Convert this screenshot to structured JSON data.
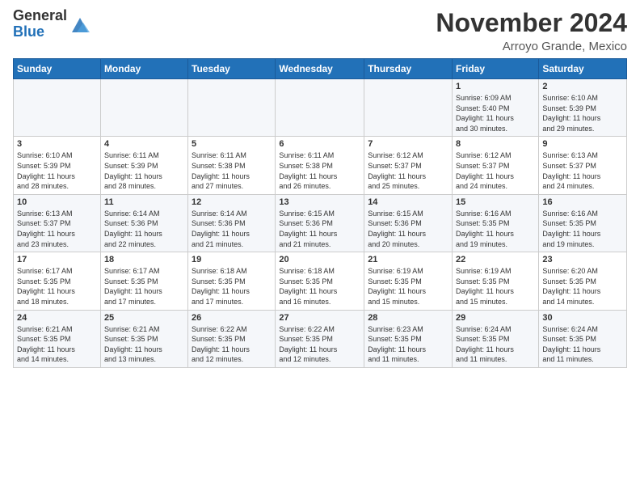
{
  "logo": {
    "general": "General",
    "blue": "Blue"
  },
  "header": {
    "month": "November 2024",
    "location": "Arroyo Grande, Mexico"
  },
  "weekdays": [
    "Sunday",
    "Monday",
    "Tuesday",
    "Wednesday",
    "Thursday",
    "Friday",
    "Saturday"
  ],
  "weeks": [
    [
      {
        "day": "",
        "info": ""
      },
      {
        "day": "",
        "info": ""
      },
      {
        "day": "",
        "info": ""
      },
      {
        "day": "",
        "info": ""
      },
      {
        "day": "",
        "info": ""
      },
      {
        "day": "1",
        "info": "Sunrise: 6:09 AM\nSunset: 5:40 PM\nDaylight: 11 hours\nand 30 minutes."
      },
      {
        "day": "2",
        "info": "Sunrise: 6:10 AM\nSunset: 5:39 PM\nDaylight: 11 hours\nand 29 minutes."
      }
    ],
    [
      {
        "day": "3",
        "info": "Sunrise: 6:10 AM\nSunset: 5:39 PM\nDaylight: 11 hours\nand 28 minutes."
      },
      {
        "day": "4",
        "info": "Sunrise: 6:11 AM\nSunset: 5:39 PM\nDaylight: 11 hours\nand 28 minutes."
      },
      {
        "day": "5",
        "info": "Sunrise: 6:11 AM\nSunset: 5:38 PM\nDaylight: 11 hours\nand 27 minutes."
      },
      {
        "day": "6",
        "info": "Sunrise: 6:11 AM\nSunset: 5:38 PM\nDaylight: 11 hours\nand 26 minutes."
      },
      {
        "day": "7",
        "info": "Sunrise: 6:12 AM\nSunset: 5:37 PM\nDaylight: 11 hours\nand 25 minutes."
      },
      {
        "day": "8",
        "info": "Sunrise: 6:12 AM\nSunset: 5:37 PM\nDaylight: 11 hours\nand 24 minutes."
      },
      {
        "day": "9",
        "info": "Sunrise: 6:13 AM\nSunset: 5:37 PM\nDaylight: 11 hours\nand 24 minutes."
      }
    ],
    [
      {
        "day": "10",
        "info": "Sunrise: 6:13 AM\nSunset: 5:37 PM\nDaylight: 11 hours\nand 23 minutes."
      },
      {
        "day": "11",
        "info": "Sunrise: 6:14 AM\nSunset: 5:36 PM\nDaylight: 11 hours\nand 22 minutes."
      },
      {
        "day": "12",
        "info": "Sunrise: 6:14 AM\nSunset: 5:36 PM\nDaylight: 11 hours\nand 21 minutes."
      },
      {
        "day": "13",
        "info": "Sunrise: 6:15 AM\nSunset: 5:36 PM\nDaylight: 11 hours\nand 21 minutes."
      },
      {
        "day": "14",
        "info": "Sunrise: 6:15 AM\nSunset: 5:36 PM\nDaylight: 11 hours\nand 20 minutes."
      },
      {
        "day": "15",
        "info": "Sunrise: 6:16 AM\nSunset: 5:35 PM\nDaylight: 11 hours\nand 19 minutes."
      },
      {
        "day": "16",
        "info": "Sunrise: 6:16 AM\nSunset: 5:35 PM\nDaylight: 11 hours\nand 19 minutes."
      }
    ],
    [
      {
        "day": "17",
        "info": "Sunrise: 6:17 AM\nSunset: 5:35 PM\nDaylight: 11 hours\nand 18 minutes."
      },
      {
        "day": "18",
        "info": "Sunrise: 6:17 AM\nSunset: 5:35 PM\nDaylight: 11 hours\nand 17 minutes."
      },
      {
        "day": "19",
        "info": "Sunrise: 6:18 AM\nSunset: 5:35 PM\nDaylight: 11 hours\nand 17 minutes."
      },
      {
        "day": "20",
        "info": "Sunrise: 6:18 AM\nSunset: 5:35 PM\nDaylight: 11 hours\nand 16 minutes."
      },
      {
        "day": "21",
        "info": "Sunrise: 6:19 AM\nSunset: 5:35 PM\nDaylight: 11 hours\nand 15 minutes."
      },
      {
        "day": "22",
        "info": "Sunrise: 6:19 AM\nSunset: 5:35 PM\nDaylight: 11 hours\nand 15 minutes."
      },
      {
        "day": "23",
        "info": "Sunrise: 6:20 AM\nSunset: 5:35 PM\nDaylight: 11 hours\nand 14 minutes."
      }
    ],
    [
      {
        "day": "24",
        "info": "Sunrise: 6:21 AM\nSunset: 5:35 PM\nDaylight: 11 hours\nand 14 minutes."
      },
      {
        "day": "25",
        "info": "Sunrise: 6:21 AM\nSunset: 5:35 PM\nDaylight: 11 hours\nand 13 minutes."
      },
      {
        "day": "26",
        "info": "Sunrise: 6:22 AM\nSunset: 5:35 PM\nDaylight: 11 hours\nand 12 minutes."
      },
      {
        "day": "27",
        "info": "Sunrise: 6:22 AM\nSunset: 5:35 PM\nDaylight: 11 hours\nand 12 minutes."
      },
      {
        "day": "28",
        "info": "Sunrise: 6:23 AM\nSunset: 5:35 PM\nDaylight: 11 hours\nand 11 minutes."
      },
      {
        "day": "29",
        "info": "Sunrise: 6:24 AM\nSunset: 5:35 PM\nDaylight: 11 hours\nand 11 minutes."
      },
      {
        "day": "30",
        "info": "Sunrise: 6:24 AM\nSunset: 5:35 PM\nDaylight: 11 hours\nand 11 minutes."
      }
    ]
  ]
}
